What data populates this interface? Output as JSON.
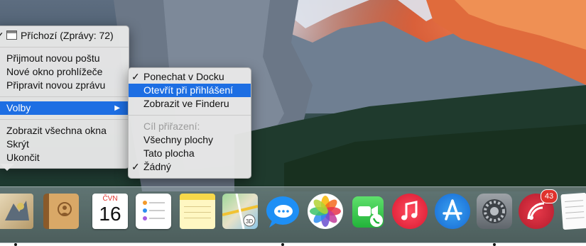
{
  "context_menu": {
    "title": "Příchozí (Zprávy: 72)",
    "items": [
      {
        "label": "Přijmout novou poštu"
      },
      {
        "label": "Nové okno prohlížeče"
      },
      {
        "label": "Připravit novou zprávu"
      },
      {
        "label": "Volby",
        "selected": true
      },
      {
        "label": "Zobrazit všechna okna"
      },
      {
        "label": "Skrýt"
      },
      {
        "label": "Ukončit"
      }
    ]
  },
  "options_submenu": {
    "items": [
      {
        "label": "Ponechat v Docku",
        "checked": true
      },
      {
        "label": "Otevřít při přihlášení",
        "selected": true
      },
      {
        "label": "Zobrazit ve Finderu"
      }
    ],
    "assign_header": "Cíl přiřazení:",
    "assign_items": [
      {
        "label": "Všechny plochy"
      },
      {
        "label": "Tato plocha"
      },
      {
        "label": "Žádný",
        "checked": true
      }
    ]
  },
  "dock": {
    "calendar_month": "ČVN",
    "calendar_day": "16",
    "news_badge": "43",
    "icons": [
      "mail-icon",
      "contacts-icon",
      "calendar-icon",
      "reminders-icon",
      "notes-icon",
      "maps-icon",
      "messages-icon",
      "photos-icon",
      "facetime-icon",
      "music-icon",
      "app-store-icon",
      "system-preferences-icon",
      "news-icon",
      "textedit-icon"
    ]
  }
}
